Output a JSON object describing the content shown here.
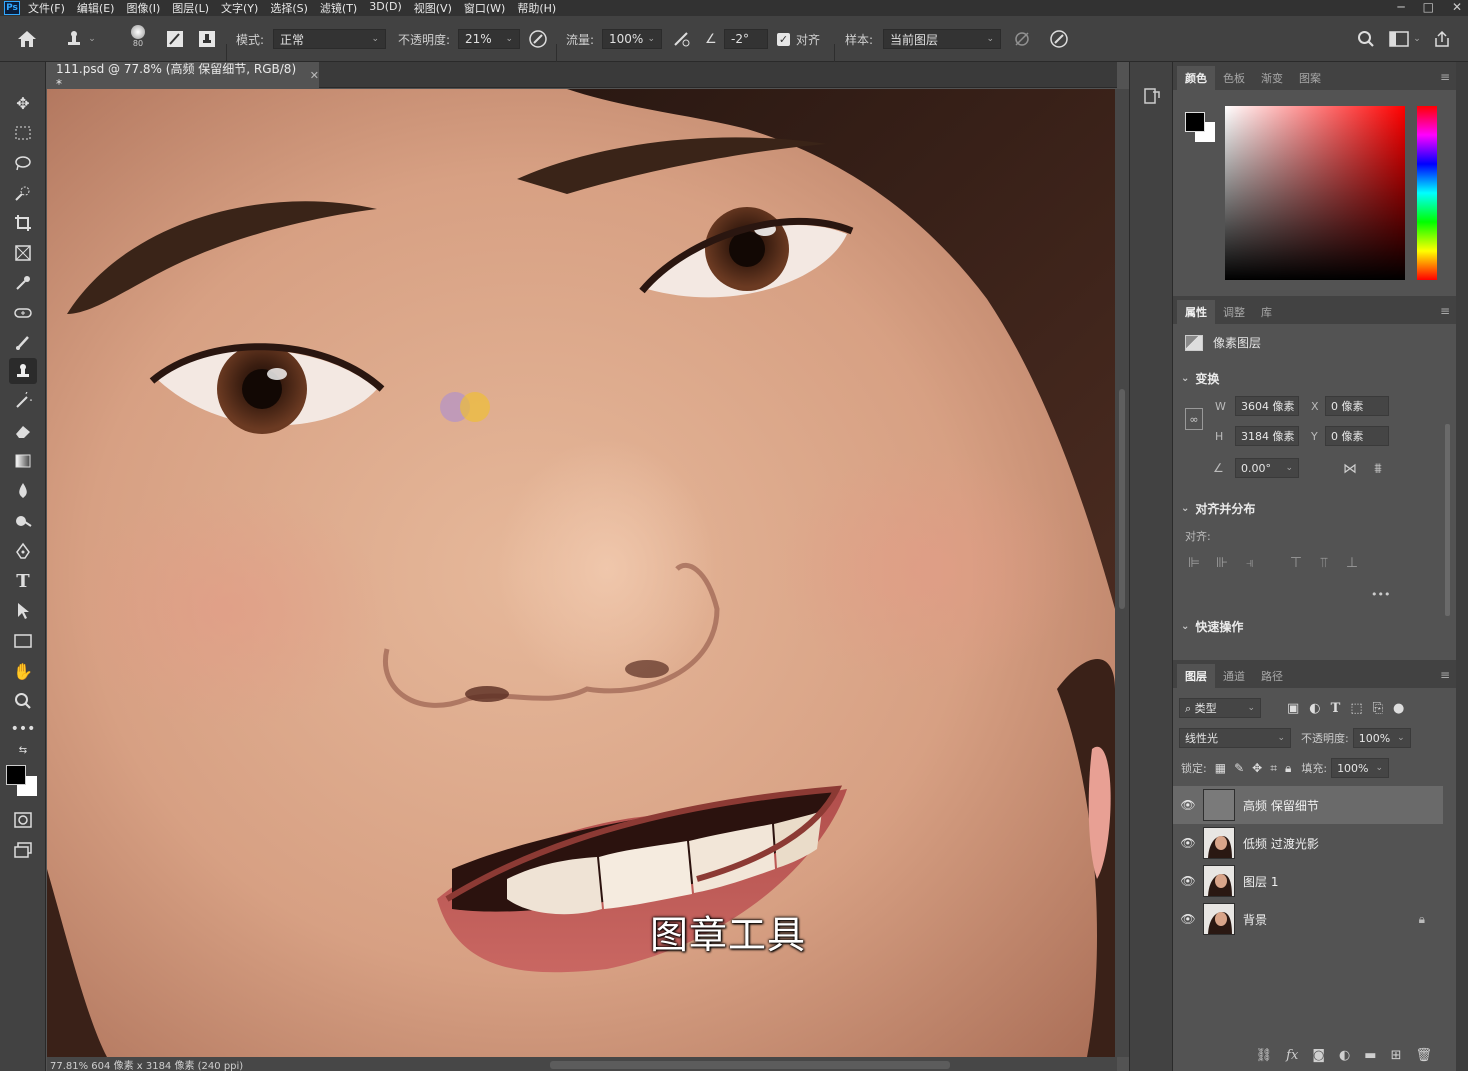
{
  "menubar": {
    "logo": "Ps",
    "items": [
      "文件(F)",
      "编辑(E)",
      "图像(I)",
      "图层(L)",
      "文字(Y)",
      "选择(S)",
      "滤镜(T)",
      "3D(D)",
      "视图(V)",
      "窗口(W)",
      "帮助(H)"
    ],
    "window_controls": [
      "─",
      "□",
      "✕"
    ]
  },
  "options": {
    "brush_size": "80",
    "mode_label": "模式:",
    "mode_value": "正常",
    "opacity_label": "不透明度:",
    "opacity_value": "21%",
    "flow_label": "流量:",
    "flow_value": "100%",
    "angle_value": "-2°",
    "aligned_label": "对齐",
    "sample_label": "样本:",
    "sample_value": "当前图层"
  },
  "document": {
    "tab_title": "111.psd @ 77.8% (高频 保留细节, RGB/8) *",
    "subtitle": "图章工具",
    "status": "77.81%   604 像素 x 3184 像素 (240 ppi)"
  },
  "color_panel": {
    "tabs": [
      "颜色",
      "色板",
      "渐变",
      "图案"
    ],
    "active_tab": "颜色",
    "foreground": "#000000",
    "background": "#ffffff",
    "hue_color": "#ff0000"
  },
  "properties_panel": {
    "tabs": [
      "属性",
      "调整",
      "库"
    ],
    "layer_type": "像素图层",
    "transform_title": "变换",
    "w_label": "W",
    "w_value": "3604 像素",
    "h_label": "H",
    "h_value": "3184 像素",
    "x_label": "X",
    "x_value": "0 像素",
    "y_label": "Y",
    "y_value": "0 像素",
    "angle_value": "0.00°",
    "align_title": "对齐并分布",
    "align_label": "对齐:",
    "quick_actions_title": "快速操作",
    "more": "•••"
  },
  "layers_panel": {
    "tabs": [
      "图层",
      "通道",
      "路径"
    ],
    "filter_kind": "类型",
    "blend_mode": "线性光",
    "opacity_label": "不透明度:",
    "opacity_value": "100%",
    "lock_label": "锁定:",
    "fill_label": "填充:",
    "fill_value": "100%",
    "layers": [
      {
        "name": "高频 保留细节",
        "selected": true,
        "thumb": "gray"
      },
      {
        "name": "低频 过渡光影",
        "selected": false,
        "thumb": "photo"
      },
      {
        "name": "图层 1",
        "selected": false,
        "thumb": "photo"
      },
      {
        "name": "背景",
        "selected": false,
        "thumb": "photo",
        "locked": true
      }
    ],
    "bottom_icons": [
      "link-icon",
      "fx-icon",
      "mask-icon",
      "adjustment-icon",
      "folder-icon",
      "new-layer-icon",
      "trash-icon"
    ]
  }
}
